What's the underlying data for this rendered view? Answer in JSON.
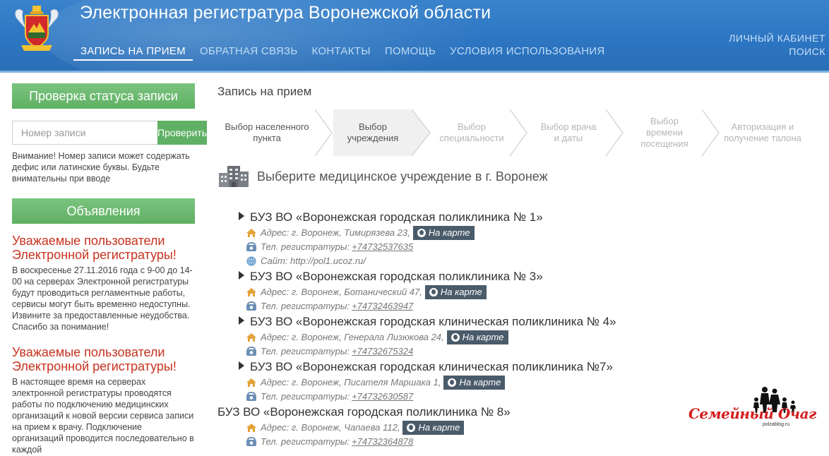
{
  "header": {
    "title": "Электронная регистратура Воронежской области",
    "nav": [
      {
        "label": "ЗАПИСЬ НА ПРИЕМ",
        "active": true
      },
      {
        "label": "ОБРАТНАЯ СВЯЗЬ",
        "active": false
      },
      {
        "label": "КОНТАКТЫ",
        "active": false
      },
      {
        "label": "ПОМОЩЬ",
        "active": false
      },
      {
        "label": "УСЛОВИЯ ИСПОЛЬЗОВАНИЯ",
        "active": false
      }
    ],
    "cabinet_label": "ЛИЧНЫЙ КАБИНЕТ",
    "search_label": "ПОИСК"
  },
  "sidebar": {
    "status_title": "Проверка статуса записи",
    "record_placeholder": "Номер записи",
    "check_button": "Проверить",
    "notice": "Внимание! Номер записи может содержать дефис или латинские буквы. Будьте внимательны при вводе",
    "announcements_title": "Объявления",
    "announcements": [
      {
        "title": "Уважаемые пользователи Электронной регистратуры!",
        "text": "В воскресенье 27.11.2016 года с 9-00 до 14-00 на серверах Электронной регистратуры будут проводиться регламентные работы, сервисы могут быть временно недоступны. Извините за предоставленные неудобства. Спасибо за понимание!"
      },
      {
        "title": "Уважаемые пользователи Электронной регистратуры!",
        "text": "В настоящее время на серверах электронной регистратуры проводятся работы по подключению медицинских организаций к новой версии сервиса записи на прием к врачу. Подключение организаций проводится последовательно в каждой"
      }
    ]
  },
  "main": {
    "title": "Запись на прием",
    "steps": [
      {
        "label": "Выбор населенного пункта",
        "state": "done"
      },
      {
        "label": "Выбор учреждения",
        "state": "current"
      },
      {
        "label": "Выбор специальности",
        "state": "future"
      },
      {
        "label": "Выбор врача и даты",
        "state": "future"
      },
      {
        "label": "Выбор времени посещения",
        "state": "future"
      },
      {
        "label": "Авторизация и получение талона",
        "state": "future"
      }
    ],
    "select_prompt": "Выберите медицинское учреждение в г. Воронеж",
    "map_label": "На карте",
    "clinics": [
      {
        "name": "БУЗ ВО «Воронежская городская поликлиника № 1»",
        "address": "Адрес: г. Воронеж, Тимирязева 23,",
        "phone_label": "Тел. регистратуры:",
        "phone": "+74732537635",
        "site": "Сайт: http://pol1.ucoz.ru/",
        "arrow": true
      },
      {
        "name": "БУЗ ВО «Воронежская городская поликлиника № 3»",
        "address": "Адрес: г. Воронеж, Ботанический 47,",
        "phone_label": "Тел. регистратуры:",
        "phone": "+74732463947",
        "site": "",
        "arrow": true
      },
      {
        "name": "БУЗ ВО «Воронежская городская клиническая поликлиника № 4»",
        "address": "Адрес: г. Воронеж, Генерала Лизюкова 24,",
        "phone_label": "Тел. регистратуры:",
        "phone": "+74732675324",
        "site": "",
        "arrow": true
      },
      {
        "name": "БУЗ ВО «Воронежская городская клиническая поликлиника №7»",
        "address": "Адрес: г. Воронеж, Писателя Маршака 1,",
        "phone_label": "Тел. регистратуры:",
        "phone": "+74732630587",
        "site": "",
        "arrow": true
      },
      {
        "name": "БУЗ ВО «Воронежская городская поликлиника № 8»",
        "address": "Адрес: г. Воронеж, Чапаева 112,",
        "phone_label": "Тел. регистратуры:",
        "phone": "+74732364878",
        "site": "",
        "arrow": false
      }
    ]
  },
  "watermark": {
    "text": "Семейный Очаг",
    "sub": "polzablog.ru"
  },
  "colors": {
    "header_blue": "#2d76c2",
    "green": "#5fb064",
    "announce_red": "#c8321f",
    "map_button": "#4a5b6a"
  }
}
